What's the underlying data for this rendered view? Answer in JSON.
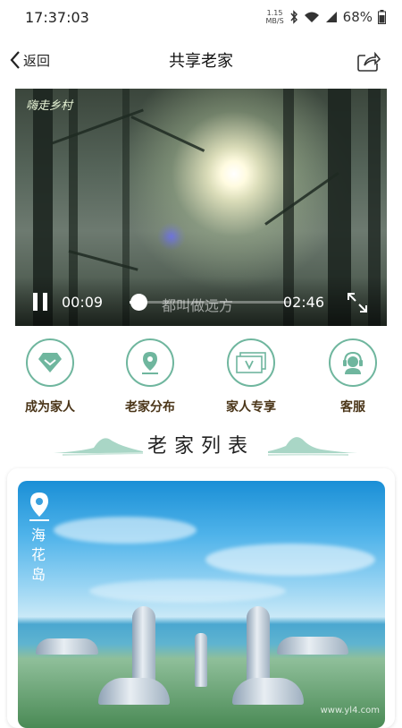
{
  "status_bar": {
    "time": "17:37:03",
    "net_speed_value": "1.15",
    "net_speed_unit": "MB/S",
    "battery": "68%"
  },
  "nav": {
    "back_label": "返回",
    "title": "共享老家",
    "share_icon": "share-icon"
  },
  "video": {
    "watermark": "嗨走乡村",
    "current_time": "00:09",
    "caption": "都叫做远方",
    "total_time": "02:46",
    "progress": 0.054
  },
  "actions": [
    {
      "label": "成为家人",
      "icon": "diamond-heart-icon"
    },
    {
      "label": "老家分布",
      "icon": "location-pin-icon"
    },
    {
      "label": "家人专享",
      "icon": "vip-card-icon"
    },
    {
      "label": "客服",
      "icon": "customer-service-icon"
    }
  ],
  "section": {
    "title": "老家列表"
  },
  "list": [
    {
      "name_chars": [
        "海",
        "花",
        "岛"
      ],
      "site_watermark": "www.yl4.com"
    }
  ],
  "colors": {
    "accent": "#6fb69e",
    "label_brown": "#4a3518"
  }
}
